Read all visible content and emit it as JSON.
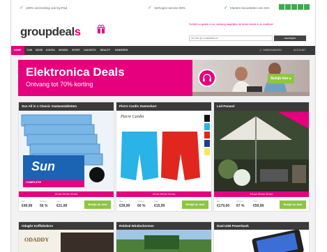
{
  "usp": [
    {
      "text": "100% verzending ook bij iPad"
    },
    {
      "text": "Verhogen service 98%"
    },
    {
      "text": "Klanten beoordelen ons met"
    }
  ],
  "trust": {
    "rating_icon": "star-rating-icon",
    "color": "#3daa4e"
  },
  "header": {
    "logo_text": "groupdeal",
    "logo_accent": "s",
    "signup_text": "Schrijf nu gratis in en ontvang dagelijks de beste deals in je mailbox!",
    "signup_placeholder": "Vul hier je e-mailadres in",
    "signup_button": "Inschrijven"
  },
  "nav": {
    "items": [
      "HOME",
      "TUIN",
      "MODE",
      "KOKEN",
      "WONEN",
      "SPORT",
      "GADGETS",
      "BEAUTY",
      "KINDEREN"
    ],
    "right": [
      "WINKELWAGEN",
      "ACCOUNT"
    ]
  },
  "banner": {
    "title": "Elektronica Deals",
    "subtitle": "Ontvang tot 70% korting",
    "cta": "Bekijk hier ▸"
  },
  "deals": [
    {
      "title": "Sun All in 1 Classic Vaatwastabletten",
      "timer": "18 uur  28 min  33 sec",
      "was_label": "Van",
      "was": "€49,99",
      "discount_label": "Korting",
      "discount": "56 %",
      "now_label": "Voor",
      "now": "€21,99",
      "button": "Bekijk de deal"
    },
    {
      "title": "Pierre Cardin Zwemshort",
      "timer": "18 uur  28 min  33 sec",
      "was_label": "Van",
      "was": "€39,99",
      "discount_label": "Korting",
      "discount": "60 %",
      "now_label": "Voor",
      "now": "€15,99",
      "button": "Bekijk de deal"
    },
    {
      "title": "Led Parasol",
      "timer": "18 uur  28 min  33 sec",
      "was_label": "Van",
      "was": "€179,00",
      "discount_label": "Korting",
      "discount": "67 %",
      "now_label": "Voor",
      "now": "€59,99",
      "button": "Bekijk de deal"
    }
  ],
  "deals_row2": [
    {
      "title": "Odaghz Koffiebekers"
    },
    {
      "title": "Roldeal Windschermen"
    },
    {
      "title": "Dual USB Powerbank"
    }
  ],
  "product_text": {
    "sun_brand": "Sun",
    "sun_tag": "COMPLETE",
    "cardin_brand": "Pierre Cardin",
    "odaddy": "ODADDY"
  },
  "colors": {
    "brand_pink": "#e6007e",
    "nav_dark": "#3a3a3a",
    "cta_green": "#8dc63f"
  }
}
